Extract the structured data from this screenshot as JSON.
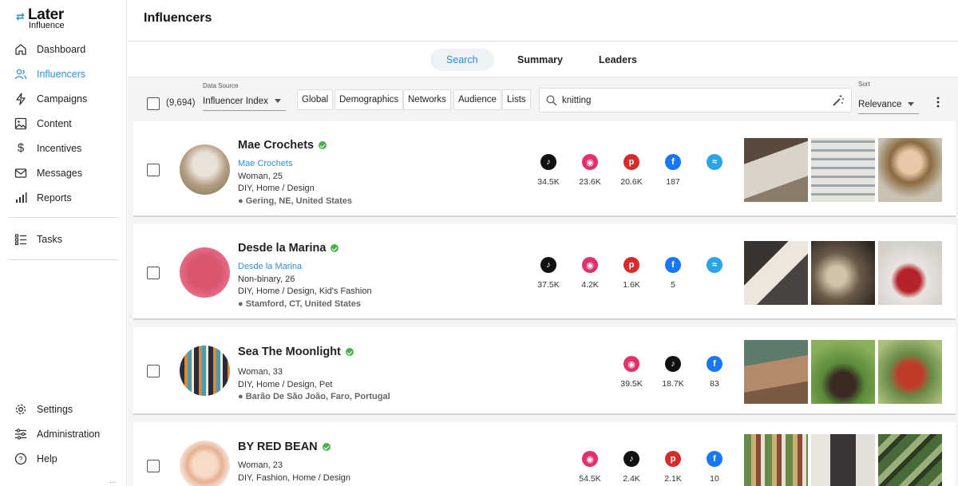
{
  "brand": {
    "name": "Later",
    "sub": "Influence"
  },
  "sidebar": {
    "items": [
      {
        "label": "Dashboard"
      },
      {
        "label": "Influencers"
      },
      {
        "label": "Campaigns"
      },
      {
        "label": "Content"
      },
      {
        "label": "Incentives"
      },
      {
        "label": "Messages"
      },
      {
        "label": "Reports"
      },
      {
        "label": "Tasks"
      },
      {
        "label": "Settings"
      },
      {
        "label": "Administration"
      },
      {
        "label": "Help"
      }
    ],
    "more": "..."
  },
  "header": {
    "title": "Influencers"
  },
  "tabs": [
    {
      "label": "Search"
    },
    {
      "label": "Summary"
    },
    {
      "label": "Leaders"
    }
  ],
  "filters": {
    "count": "(9,694)",
    "data_source_label": "Data Source",
    "data_source_value": "Influencer Index",
    "buttons": [
      "Global",
      "Demographics",
      "Networks",
      "Audience",
      "Lists"
    ],
    "search_value": "knitting",
    "sort_label": "Sort",
    "sort_value": "Relevance"
  },
  "colors": {
    "accent": "#2f8fd6",
    "tiktok": "#111111",
    "instagram": "#e1306c",
    "pinterest": "#d62b2b",
    "facebook": "#1877f2",
    "blog": "#2aa4e6",
    "verified": "#4cb050"
  },
  "influencers": [
    {
      "name": "Mae Crochets",
      "handle": "Mae Crochets",
      "demo": "Woman, 25",
      "categories": "DIY, Home / Design",
      "location": "Gering, NE, United States",
      "networks": [
        {
          "icon": "tiktok-icon",
          "count": "34.5K"
        },
        {
          "icon": "instagram-icon",
          "count": "23.6K"
        },
        {
          "icon": "pinterest-icon",
          "count": "20.6K"
        },
        {
          "icon": "facebook-icon",
          "count": "187"
        },
        {
          "icon": "blog-icon",
          "count": ""
        }
      ]
    },
    {
      "name": "Desde la Marina",
      "handle": "Desde la Marina",
      "demo": "Non-binary, 26",
      "categories": "DIY, Home / Design, Kid's Fashion",
      "location": "Stamford, CT, United States",
      "networks": [
        {
          "icon": "tiktok-icon",
          "count": "37.5K"
        },
        {
          "icon": "instagram-icon",
          "count": "4.2K"
        },
        {
          "icon": "pinterest-icon",
          "count": "1.6K"
        },
        {
          "icon": "facebook-icon",
          "count": "5"
        },
        {
          "icon": "blog-icon",
          "count": ""
        }
      ]
    },
    {
      "name": "Sea The Moonlight",
      "demo": "Woman, 33",
      "categories": "DIY, Home / Design, Pet",
      "location": "Barão De São João, Faro, Portugal",
      "networks": [
        {
          "icon": "instagram-icon",
          "count": "39.5K"
        },
        {
          "icon": "tiktok-icon",
          "count": "18.7K"
        },
        {
          "icon": "facebook-icon",
          "count": "83"
        }
      ]
    },
    {
      "name": "BY RED BEAN",
      "demo": "Woman, 23",
      "categories": "DIY, Fashion, Home / Design",
      "networks": [
        {
          "icon": "instagram-icon",
          "count": "54.5K"
        },
        {
          "icon": "tiktok-icon",
          "count": "2.4K"
        },
        {
          "icon": "pinterest-icon",
          "count": "2.1K"
        },
        {
          "icon": "facebook-icon",
          "count": "10"
        }
      ]
    }
  ]
}
